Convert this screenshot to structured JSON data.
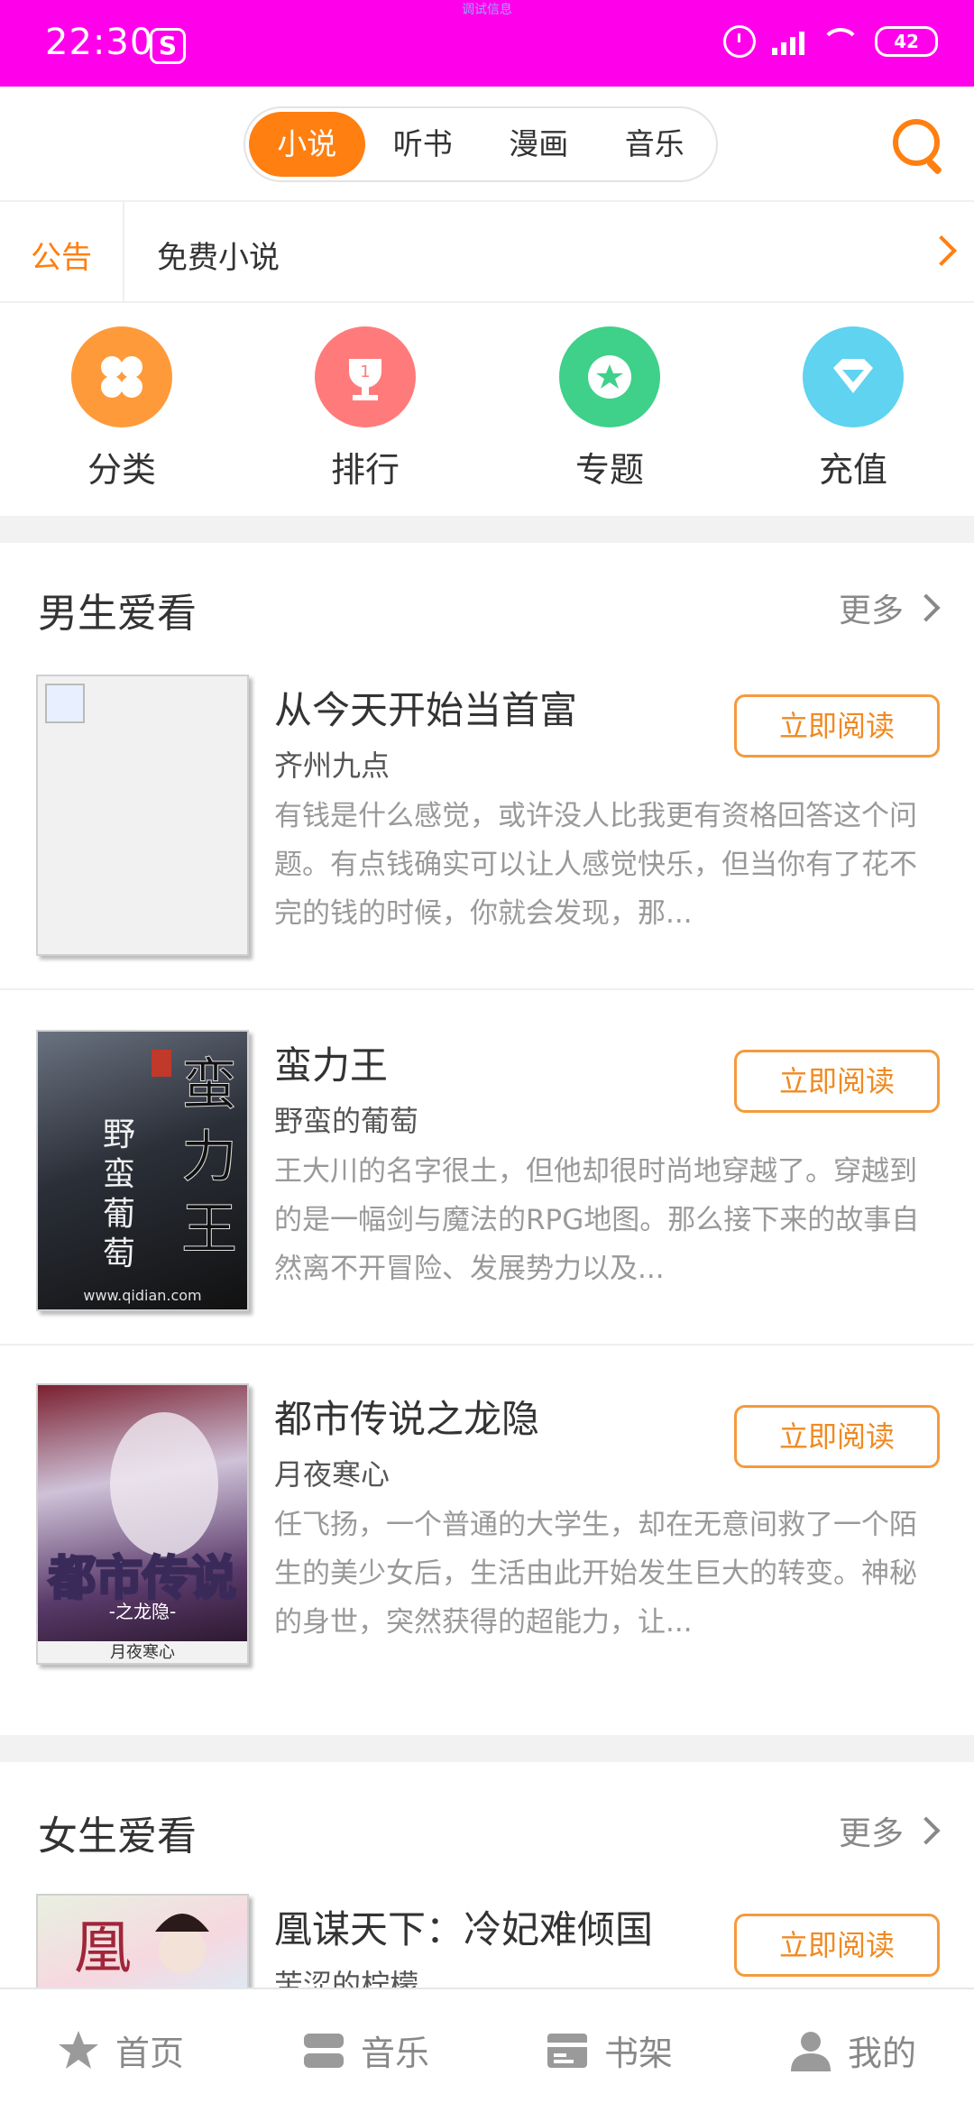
{
  "status_bar": {
    "time": "22:30",
    "app_glyph": "S",
    "tiny_text": "调试信息",
    "battery": "42"
  },
  "top_tabs": [
    {
      "label": "小说",
      "active": true
    },
    {
      "label": "听书",
      "active": false
    },
    {
      "label": "漫画",
      "active": false
    },
    {
      "label": "音乐",
      "active": false
    }
  ],
  "notice": {
    "label": "公告",
    "text": "免费小说"
  },
  "quick_entries": [
    {
      "label": "分类",
      "color": "#ff9a3a",
      "icon": "grid-icon"
    },
    {
      "label": "排行",
      "color": "#ff7b7b",
      "icon": "trophy-icon"
    },
    {
      "label": "专题",
      "color": "#3fd08a",
      "icon": "star-icon"
    },
    {
      "label": "充值",
      "color": "#5fd3f0",
      "icon": "diamond-icon"
    }
  ],
  "sections": [
    {
      "title": "男生爱看",
      "more": "更多",
      "books": [
        {
          "title": "从今天开始当首富",
          "author": "齐州九点",
          "desc": "有钱是什么感觉，或许没人比我更有资格回答这个问题。有点钱确实可以让人感觉快乐，但当你有了花不完的钱的时候，你就会发现，那...",
          "button": "立即阅读"
        },
        {
          "title": "蛮力王",
          "author": "野蛮的葡萄",
          "desc": "王大川的名字很土，但他却很时尚地穿越了。穿越到的是一幅剑与魔法的RPG地图。那么接下来的故事自然离不开冒险、发展势力以及...",
          "button": "立即阅读",
          "cover_text": "蛮力王"
        },
        {
          "title": "都市传说之龙隐",
          "author": "月夜寒心",
          "desc": "任飞扬，一个普通的大学生，却在无意间救了一个陌生的美少女后，生活由此开始发生巨大的转变。神秘的身世，突然获得的超能力，让...",
          "button": "立即阅读",
          "cover_text": "都市传说"
        }
      ]
    },
    {
      "title": "女生爱看",
      "more": "更多",
      "books": [
        {
          "title": "凰谋天下：冷妃难倾国",
          "author": "苦涩的柠檬",
          "button": "立即阅读"
        }
      ]
    }
  ],
  "bottom_nav": [
    {
      "label": "首页",
      "icon": "star-icon"
    },
    {
      "label": "音乐",
      "icon": "music-icon"
    },
    {
      "label": "书架",
      "icon": "bookshelf-icon"
    },
    {
      "label": "我的",
      "icon": "user-icon"
    }
  ]
}
